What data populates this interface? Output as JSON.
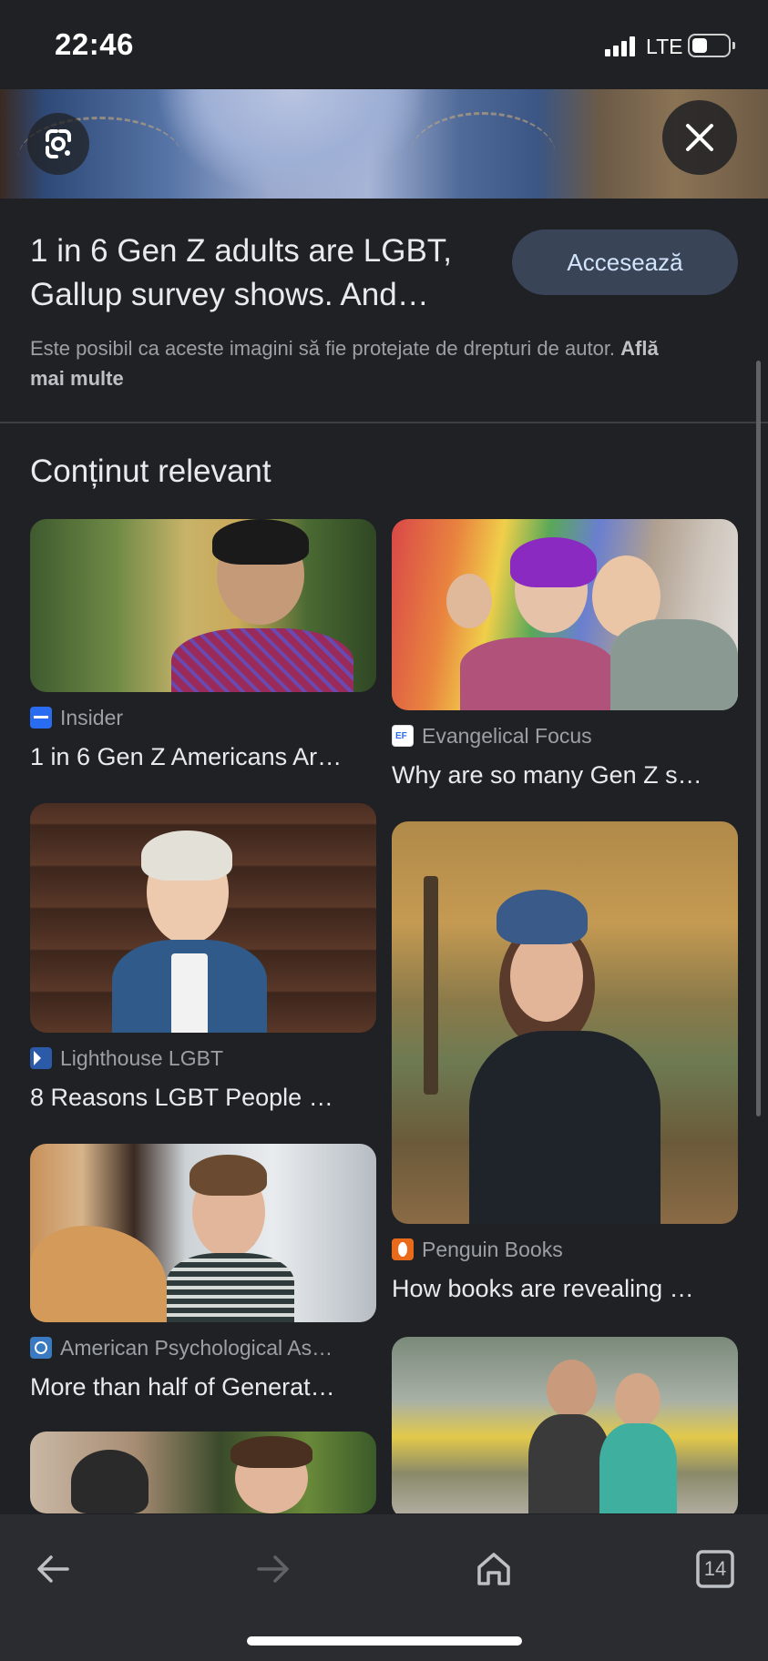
{
  "status_bar": {
    "time": "22:46",
    "network": "LTE",
    "battery_level": 0.35,
    "signal_bars": 4
  },
  "hero": {
    "lens_icon": "google-lens-icon",
    "close_icon": "close-icon"
  },
  "result": {
    "title": "1 in 6 Gen Z adults are LGBT, Gallup survey shows. And…",
    "visit_label": "Accesează",
    "copyright_text": "Este posibil ca aceste imagini să fie protejate de drepturi de autor.",
    "learn_more": "Află mai multe"
  },
  "related": {
    "heading": "Conținut relevant",
    "items": [
      {
        "source": "Insider",
        "source_icon": "insider-favicon",
        "title": "1 in 6 Gen Z Americans Ar…"
      },
      {
        "source": "Evangelical Focus",
        "source_icon": "evangelical-focus-favicon",
        "title": "Why are so many Gen Z s…"
      },
      {
        "source": "Lighthouse LGBT",
        "source_icon": "lighthouse-lgbt-favicon",
        "title": "8 Reasons LGBT People …"
      },
      {
        "source": "Penguin Books",
        "source_icon": "penguin-books-favicon",
        "title": "How books are revealing …"
      },
      {
        "source": "American Psychological As…",
        "source_icon": "apa-favicon",
        "title": "More than half of Generat…"
      },
      {
        "source": "",
        "source_icon": "",
        "title": ""
      },
      {
        "source": "",
        "source_icon": "",
        "title": ""
      }
    ]
  },
  "toolbar": {
    "back_icon": "back-arrow-icon",
    "forward_icon": "forward-arrow-icon",
    "home_icon": "home-icon",
    "tabs_icon": "tabs-icon",
    "tab_count": "14"
  },
  "colors": {
    "background": "#202124",
    "toolbar": "#2b2c2f",
    "button": "#394457",
    "button_text": "#d2e3fc",
    "secondary_text": "#9aa0a6"
  }
}
